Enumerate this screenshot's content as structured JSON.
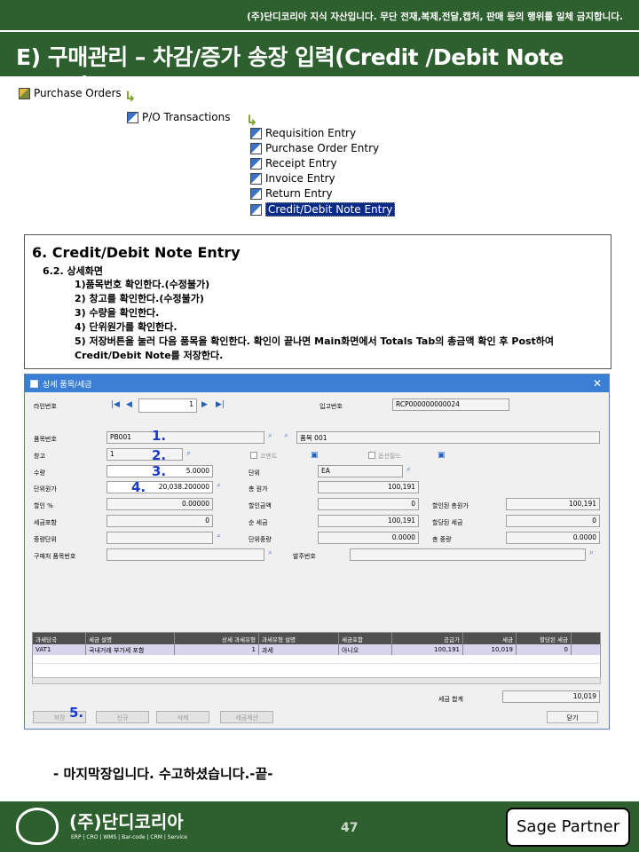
{
  "notice": "(주)단디코리아 지식 자산입니다. 무단 전재,복제,전달,캡처, 판매 등의 행위를 일체 금지합니다.",
  "header_title": "E) 구매관리 – 차감/증가 송장 입력(Credit /Debit Note Entry)",
  "tree": {
    "root": "Purchase Orders",
    "level1": "P/O Transactions",
    "items": [
      "Requisition Entry",
      "Purchase Order Entry",
      "Receipt Entry",
      "Invoice Entry",
      "Return Entry",
      "Credit/Debit Note Entry"
    ],
    "selected": "Credit/Debit Note Entry"
  },
  "description": {
    "title": "6. Credit/Debit Note Entry",
    "subtitle": "6.2. 상세화면",
    "lines": [
      "1)품목번호 확인한다.(수정불가)",
      "2) 창고를 확인한다.(수정불가)",
      "3) 수량을 확인한다.",
      "4) 단위원가를 확인한다.",
      "5)  저장버튼을 눌러 다음 품목을 확인한다. 확인이 끝나면 Main화면에서 Totals Tab의 총금액 확인 후 Post하여",
      "Credit/Debit Note를 저장한다."
    ]
  },
  "window": {
    "title": "상세 품목/세금",
    "close": "✕",
    "line_label": "라인번호",
    "line_value": "1",
    "receipt_label": "입고번호",
    "receipt_value": "RCP000000000024",
    "item_label": "품목번호",
    "item_value": "PB001",
    "item_desc": "품목 001",
    "warehouse_label": "창고",
    "warehouse_value": "1",
    "comment_label": "코멘트",
    "optional_label": "옵션필드",
    "qty_label": "수량",
    "qty_value": "5.0000",
    "unit_label": "단위",
    "unit_value": "EA",
    "unit_cost_label": "단위원가",
    "unit_cost_value": "20,038.200000",
    "total_cost_label": "총 원가",
    "total_cost_value": "100,191",
    "discount_pct_label": "할인 %",
    "discount_pct_value": "0.00000",
    "discount_amt_label": "할인금액",
    "discount_amt_value": "0",
    "disc_total_label": "할인된 총원가",
    "disc_total_value": "100,191",
    "tax_incl_label": "세금포함",
    "tax_incl_value": "0",
    "net_tax_label": "순 세금",
    "net_tax_value": "100,191",
    "alloc_tax_label": "할당된 세금",
    "alloc_tax_value": "0",
    "weight_unit_label": "중량단위",
    "unit_weight_label": "단위중량",
    "unit_weight_value": "0.0000",
    "total_weight_label": "총 중량",
    "total_weight_value": "0.0000",
    "vendor_item_label": "구매처 품목번호",
    "order_no_label": "발주번호",
    "grid_headers": [
      "과세당국",
      "세금 설명",
      "상세 과세유형",
      "과세유형 설명",
      "세금포함",
      "공급가",
      "세금",
      "할당된 세금"
    ],
    "grid_rows": [
      [
        "VAT1",
        "국내거래 부가세 포함",
        "1",
        "과세",
        "아니오",
        "100,191",
        "10,019",
        "0"
      ]
    ],
    "tax_total_label": "세금 합계",
    "tax_total_value": "10,019",
    "btn_save": "저장",
    "btn_new": "신규",
    "btn_delete": "삭제",
    "btn_calc": "세금계산",
    "btn_close": "닫기"
  },
  "step_markers": [
    "1.",
    "2.",
    "3.",
    "4.",
    "5."
  ],
  "ending": "- 마지막장입니다. 수고하셨습니다.-끝-",
  "footer": {
    "company": "(주)단디코리아",
    "company_sub": "ERP | CRO | WMS | Bar-code | CRM | Service",
    "page": "47",
    "partner": "Sage Partner"
  }
}
